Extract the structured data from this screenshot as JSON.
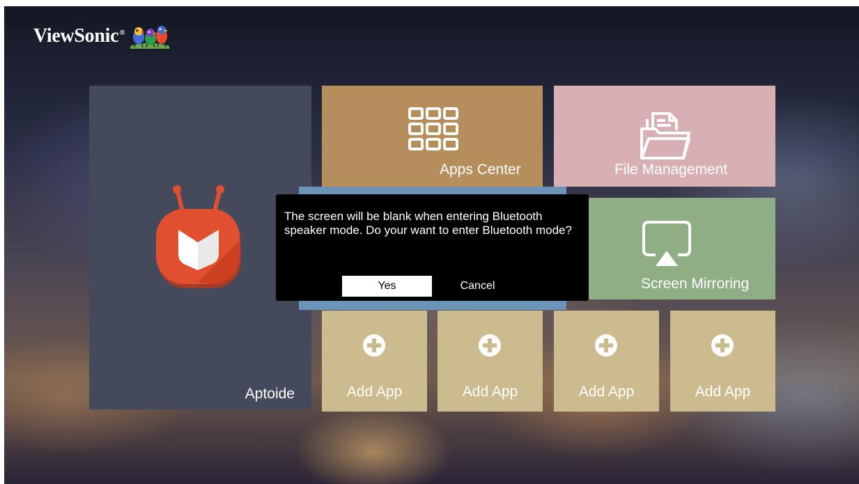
{
  "brand": {
    "name": "ViewSonic",
    "registered": "®"
  },
  "tiles": {
    "aptoide": {
      "label": "Aptoide",
      "icon": "aptoide-tv-icon"
    },
    "apps_center": {
      "label": "Apps Center",
      "icon": "apps-grid-icon"
    },
    "file_management": {
      "label": "File Management",
      "icon": "folder-files-icon"
    },
    "screen_mirroring": {
      "label": "Screen Mirroring",
      "icon": "screen-cast-icon"
    },
    "bluetooth": {
      "icon": "bluetooth-tile"
    },
    "add_apps": [
      {
        "label": "Add App",
        "icon": "plus-circle-icon"
      },
      {
        "label": "Add App",
        "icon": "plus-circle-icon"
      },
      {
        "label": "Add App",
        "icon": "plus-circle-icon"
      },
      {
        "label": "Add App",
        "icon": "plus-circle-icon"
      }
    ]
  },
  "dialog": {
    "message": "The screen will be blank when entering Bluetooth speaker mode. Do your want to enter Bluetooth mode?",
    "yes_label": "Yes",
    "cancel_label": "Cancel"
  },
  "colors": {
    "aptoide_tile": "#444a5c",
    "apps_tile": "#b58e5c",
    "files_tile": "#d8afb2",
    "mirror_tile": "#8fae86",
    "bluetooth_tile": "#6c94b9",
    "add_tile": "#cbbb8f",
    "aptoide_red": "#e0502f"
  }
}
